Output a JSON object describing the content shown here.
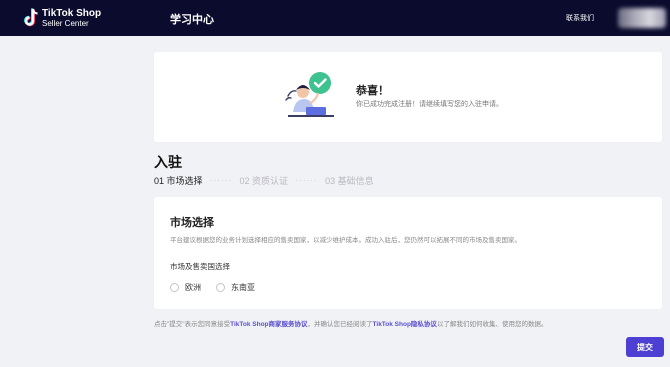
{
  "header": {
    "brand_line1": "TikTok Shop",
    "brand_line2": "Seller Center",
    "nav_title": "学习中心",
    "contact": "联系我们"
  },
  "success": {
    "title": "恭喜！",
    "description": "你已成功完成注册！请继续填写您的入驻申请。"
  },
  "page": {
    "title": "入驻",
    "steps": [
      {
        "label": "01 市场选择",
        "active": true
      },
      {
        "label": "02 资质认证",
        "active": false
      },
      {
        "label": "03 基础信息",
        "active": false
      }
    ],
    "step_separator": "······"
  },
  "market": {
    "title": "市场选择",
    "description": "平台建议根据您的业务计划选择相应的售卖国家，以减少维护成本。成功入驻后，您仍然可以拓展不同的市场及售卖国家。",
    "field_label": "市场及售卖国选择",
    "options": [
      "欧洲",
      "东南亚"
    ]
  },
  "agreement": {
    "prefix": "点击\"提交\"表示您同意接受",
    "link1": "TikTok Shop商家服务协议",
    "middle": "，并确认您已经阅读了",
    "link2": "TikTok Shop隐私协议",
    "suffix": "以了解我们如何收集、使用您的数据。"
  },
  "submit_label": "提交",
  "colors": {
    "topbar": "#0b0b2e",
    "primary": "#4c3fd1",
    "background": "#f1f2f5",
    "success_badge": "#3ec28f"
  }
}
